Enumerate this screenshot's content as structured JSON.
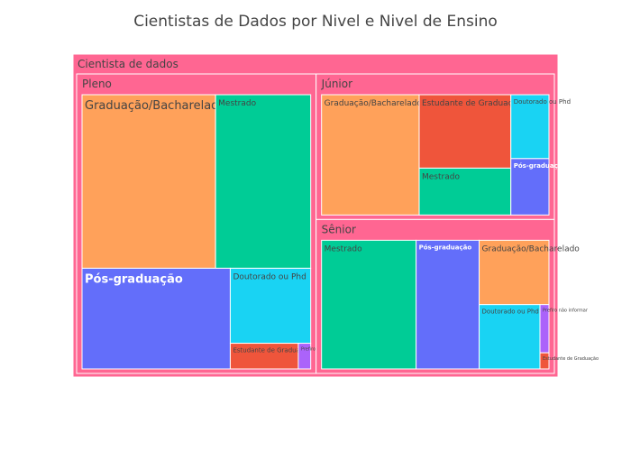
{
  "chart_data": {
    "type": "treemap",
    "title": "Cientistas de Dados por Nivel e Nivel de Ensino",
    "root": {
      "label": "Cientista de dados",
      "color": "#ff6692",
      "children": [
        {
          "label": "Pleno",
          "color": "#ff6692",
          "children": [
            {
              "label": "Graduação/Bacharelado",
              "value": 146,
              "color": "#ffa15a"
            },
            {
              "label": "Mestrado",
              "value": 104,
              "color": "#00cc96"
            },
            {
              "label": "Pós-graduação",
              "value": 94,
              "color": "#636efa"
            },
            {
              "label": "Doutorado ou Phd",
              "value": 38,
              "color": "#19d3f3"
            },
            {
              "label": "Estudante de Graduação",
              "value": 11,
              "color": "#ef553b"
            },
            {
              "label": "Prefiro não informar",
              "value": 2,
              "color": "#ab63fa"
            }
          ]
        },
        {
          "label": "Júnior",
          "color": "#ff6692",
          "children": [
            {
              "label": "Graduação/Bacharelado",
              "value": 82,
              "color": "#ffa15a"
            },
            {
              "label": "Estudante de Graduação",
              "value": 47,
              "color": "#ef553b"
            },
            {
              "label": "Mestrado",
              "value": 30,
              "color": "#00cc96"
            },
            {
              "label": "Doutorado ou Phd",
              "value": 17,
              "color": "#19d3f3"
            },
            {
              "label": "Pós-graduação",
              "value": 15,
              "color": "#636efa"
            }
          ]
        },
        {
          "label": "Sênior",
          "color": "#ff6692",
          "children": [
            {
              "label": "Mestrado",
              "value": 84,
              "color": "#00cc96"
            },
            {
              "label": "Pós-graduação",
              "value": 56,
              "color": "#636efa"
            },
            {
              "label": "Graduação/Bacharelado",
              "value": 31,
              "color": "#ffa15a"
            },
            {
              "label": "Doutorado ou Phd",
              "value": 27,
              "color": "#19d3f3"
            },
            {
              "label": "Prefiro não informar",
              "value": 3,
              "color": "#ab63fa"
            },
            {
              "label": "Estudante de Graduação",
              "value": 1,
              "color": "#ef553b"
            }
          ]
        }
      ]
    }
  }
}
